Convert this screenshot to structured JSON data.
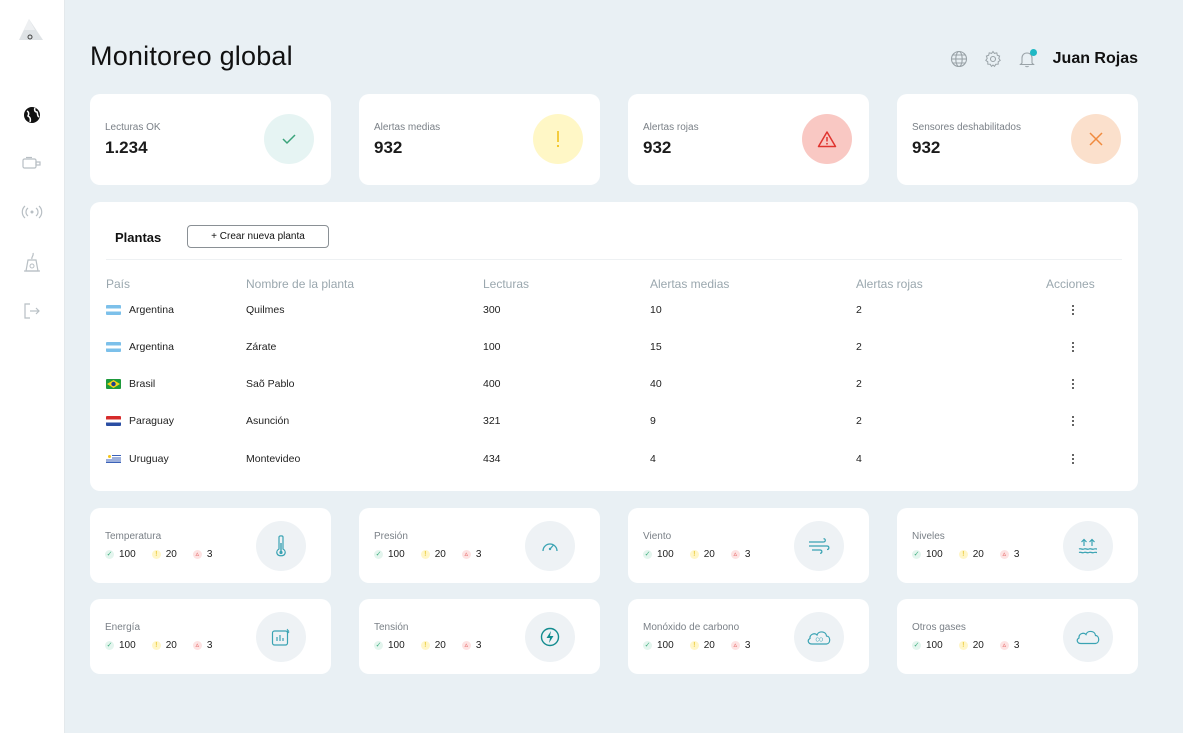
{
  "header": {
    "title": "Monitoreo global",
    "user_name": "Juan Rojas"
  },
  "sidebar": {
    "items": [
      {
        "icon": "globe-icon"
      },
      {
        "icon": "camera-sensor-icon"
      },
      {
        "icon": "antenna-signal-icon"
      },
      {
        "icon": "plant-factory-icon"
      },
      {
        "icon": "logout-icon"
      }
    ]
  },
  "kpis": [
    {
      "label": "Lecturas OK",
      "value": "1.234",
      "icon": "check-icon",
      "color": "#e6f4f3"
    },
    {
      "label": "Alertas medias",
      "value": "932",
      "icon": "exclamation-icon",
      "color": "#fff7c6"
    },
    {
      "label": "Alertas rojas",
      "value": "932",
      "icon": "warning-triangle-icon",
      "color": "#f9c8c3"
    },
    {
      "label": "Sensores deshabilitados",
      "value": "932",
      "icon": "x-icon",
      "color": "#fbe0cc"
    }
  ],
  "plants": {
    "title": "Plantas",
    "create_button": "+ Crear nueva planta",
    "columns": [
      "País",
      "Nombre de la planta",
      "Lecturas",
      "Alertas medias",
      "Alertas rojas",
      "Acciones"
    ],
    "rows": [
      {
        "country": "Argentina",
        "name": "Quilmes",
        "readings": "300",
        "medium": "10",
        "red": "2"
      },
      {
        "country": "Argentina",
        "name": "Zárate",
        "readings": "100",
        "medium": "15",
        "red": "2"
      },
      {
        "country": "Brasil",
        "name": "Saõ Pablo",
        "readings": "400",
        "medium": "40",
        "red": "2"
      },
      {
        "country": "Paraguay",
        "name": "Asunción",
        "readings": "321",
        "medium": "9",
        "red": "2"
      },
      {
        "country": "Uruguay",
        "name": "Montevideo",
        "readings": "434",
        "medium": "4",
        "red": "4"
      }
    ]
  },
  "sensors": [
    {
      "label": "Temperatura",
      "ok": "100",
      "warn": "20",
      "err": "3",
      "icon": "thermometer-icon"
    },
    {
      "label": "Presión",
      "ok": "100",
      "warn": "20",
      "err": "3",
      "icon": "gauge-icon"
    },
    {
      "label": "Viento",
      "ok": "100",
      "warn": "20",
      "err": "3",
      "icon": "wind-icon"
    },
    {
      "label": "Niveles",
      "ok": "100",
      "warn": "20",
      "err": "3",
      "icon": "water-level-icon"
    },
    {
      "label": "Energía",
      "ok": "100",
      "warn": "20",
      "err": "3",
      "icon": "energy-chart-icon"
    },
    {
      "label": "Tensión",
      "ok": "100",
      "warn": "20",
      "err": "3",
      "icon": "lightning-icon"
    },
    {
      "label": "Monóxido de carbono",
      "ok": "100",
      "warn": "20",
      "err": "3",
      "icon": "co-cloud-icon"
    },
    {
      "label": "Otros gases",
      "ok": "100",
      "warn": "20",
      "err": "3",
      "icon": "cloud-icon"
    }
  ],
  "colors": {
    "accent": "#1fb8c4",
    "icon_teal": "#3aa3b3",
    "background": "#e9f0f4"
  }
}
